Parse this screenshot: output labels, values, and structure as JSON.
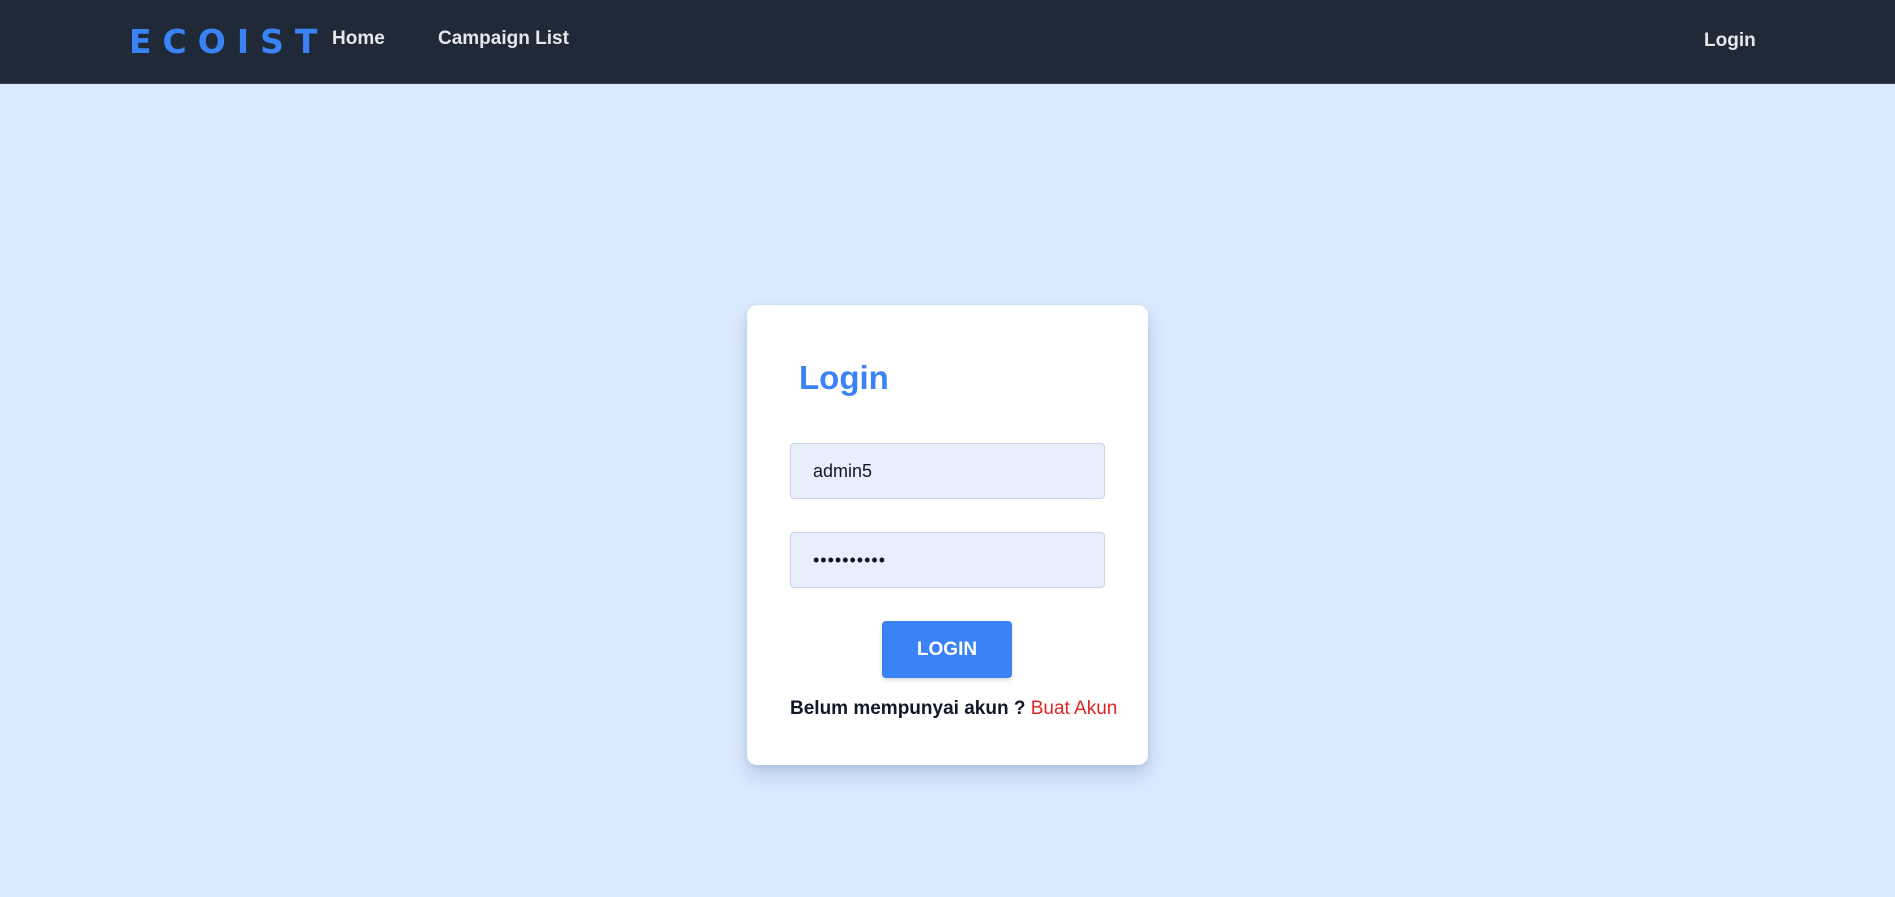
{
  "navbar": {
    "brand": "ECOIST",
    "links": [
      {
        "label": "Home"
      },
      {
        "label": "Campaign List"
      }
    ],
    "login_label": "Login"
  },
  "login_card": {
    "title": "Login",
    "username": {
      "value": "admin5",
      "placeholder": ""
    },
    "password": {
      "value": "••••••••••",
      "placeholder": ""
    },
    "submit_label": "LOGIN",
    "register_prompt": "Belum mempunyai akun ?",
    "register_link": "Buat Akun"
  },
  "colors": {
    "navbar_bg": "#1f2937",
    "page_bg": "#dbeafe",
    "accent": "#3b82f6",
    "link_red": "#dc2626"
  }
}
